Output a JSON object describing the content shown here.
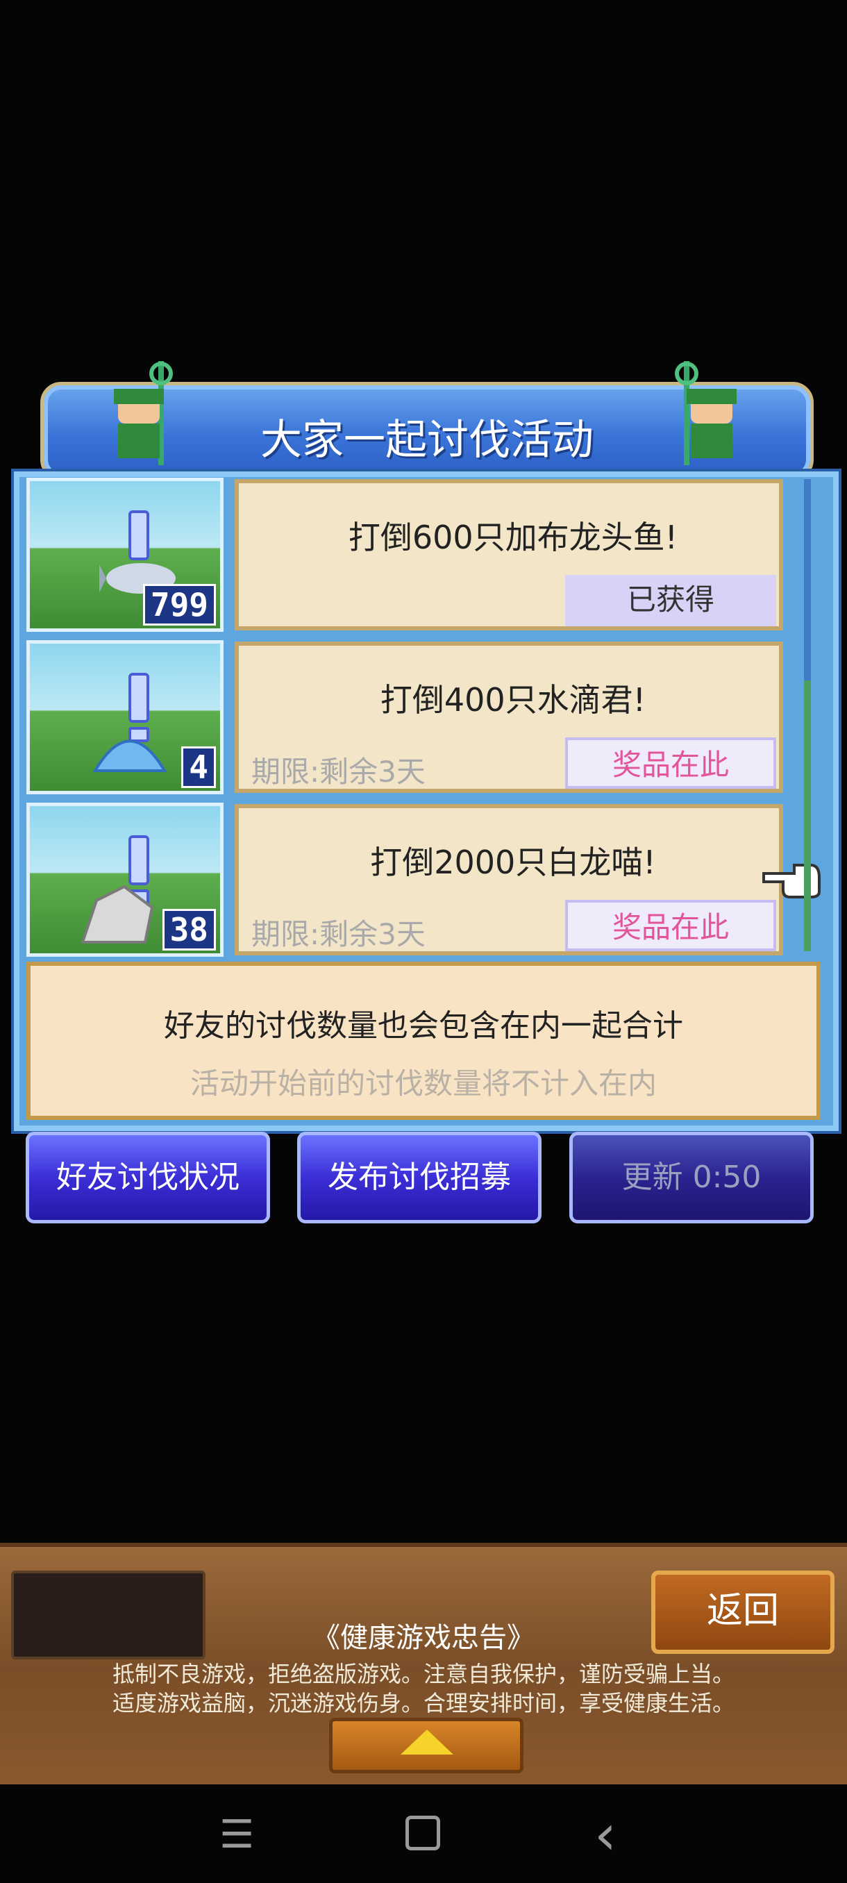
{
  "header": {
    "title": "大家一起讨伐活动"
  },
  "quests": [
    {
      "title": "打倒600只加布龙头鱼!",
      "deadline": "",
      "button": "已获得",
      "status": "obtained",
      "count": "799"
    },
    {
      "title": "打倒400只水滴君!",
      "deadline": "期限:剩余3天",
      "button": "奖品在此",
      "status": "available",
      "count": "4"
    },
    {
      "title": "打倒2000只白龙喵!",
      "deadline": "期限:剩余3天",
      "button": "奖品在此",
      "status": "available",
      "count": "38"
    }
  ],
  "info": {
    "main": "好友的讨伐数量也会包含在内一起合计",
    "sub": "活动开始前的讨伐数量将不计入在内"
  },
  "actions": {
    "friend_status": "好友讨伐状况",
    "publish": "发布讨伐招募",
    "refresh": "更新 0:50"
  },
  "footer": {
    "back": "返回",
    "notice_title": "《健康游戏忠告》",
    "notice_line1": "抵制不良游戏，拒绝盗版游戏。注意自我保护，谨防受骗上当。",
    "notice_line2": "适度游戏益脑，沉迷游戏伤身。合理安排时间，享受健康生活。"
  },
  "nav": {
    "menu": "☰",
    "home": "",
    "back": "‹"
  },
  "colors": {
    "accent_pink": "#e2559a",
    "panel_blue": "#5ea6e0",
    "card_bg": "#f3e6c8"
  }
}
